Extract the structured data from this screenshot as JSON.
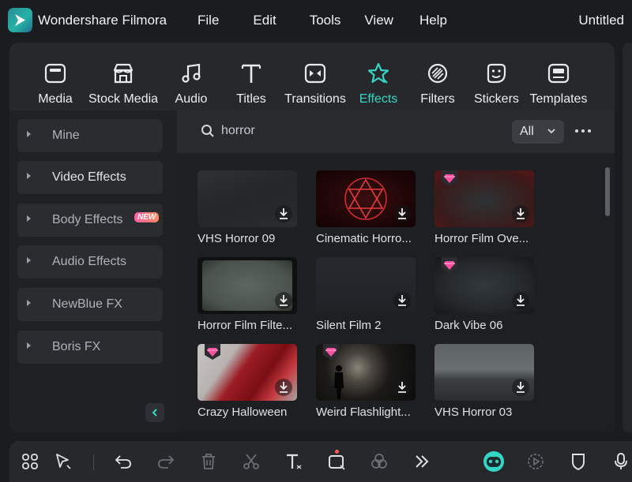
{
  "app": {
    "name": "Wondershare Filmora",
    "document_title": "Untitled",
    "accent": "#35d5c3"
  },
  "menu": [
    "File",
    "Edit",
    "Tools",
    "View",
    "Help"
  ],
  "tabs": [
    {
      "label": "Media",
      "icon": "media-icon"
    },
    {
      "label": "Stock Media",
      "icon": "stock-media-icon"
    },
    {
      "label": "Audio",
      "icon": "audio-note-icon"
    },
    {
      "label": "Titles",
      "icon": "titles-t-icon"
    },
    {
      "label": "Transitions",
      "icon": "transitions-icon"
    },
    {
      "label": "Effects",
      "icon": "effects-star-icon",
      "active": true
    },
    {
      "label": "Filters",
      "icon": "filters-icon"
    },
    {
      "label": "Stickers",
      "icon": "stickers-icon"
    },
    {
      "label": "Templates",
      "icon": "templates-icon"
    }
  ],
  "sidebar": {
    "items": [
      {
        "label": "Mine"
      },
      {
        "label": "Video Effects"
      },
      {
        "label": "Body Effects",
        "badge": "NEW"
      },
      {
        "label": "Audio Effects"
      },
      {
        "label": "NewBlue FX"
      },
      {
        "label": "Boris FX"
      }
    ]
  },
  "search": {
    "value": "horror",
    "placeholder": ""
  },
  "filter": {
    "selected": "All"
  },
  "effects": [
    {
      "name": "VHS Horror 09",
      "premium": false
    },
    {
      "name": "Cinematic Horro...",
      "premium": false
    },
    {
      "name": "Horror Film Ove...",
      "premium": true
    },
    {
      "name": "Horror Film Filte...",
      "premium": false
    },
    {
      "name": "Silent Film 2",
      "premium": false
    },
    {
      "name": "Dark Vibe 06",
      "premium": true
    },
    {
      "name": "Crazy Halloween",
      "premium": true
    },
    {
      "name": "Weird Flashlight...",
      "premium": true
    },
    {
      "name": "VHS Horror 03",
      "premium": false
    }
  ],
  "toolbar": [
    "layout-grid-icon",
    "select-arrow-icon",
    "undo-icon",
    "redo-icon",
    "delete-icon",
    "cut-icon",
    "text-icon",
    "crop-icon",
    "color-icon",
    "more-arrows-icon",
    "ai-mascot-icon",
    "play-circle-icon",
    "shield-icon",
    "mic-icon"
  ]
}
